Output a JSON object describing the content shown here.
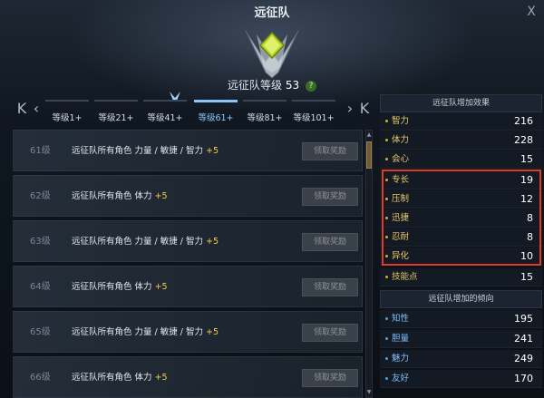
{
  "window": {
    "title": "远征队",
    "close_label": "X",
    "level_label": "远征队等级",
    "level_value": "53",
    "help_label": "?"
  },
  "tabs": {
    "first_label": "K",
    "prev_label": "‹",
    "next_label": "›",
    "last_label": "K",
    "items": [
      {
        "label": "等级1+"
      },
      {
        "label": "等级21+"
      },
      {
        "label": "等级41+"
      },
      {
        "label": "等级61+",
        "active": true
      },
      {
        "label": "等级81+"
      },
      {
        "label": "等级101+"
      }
    ]
  },
  "rewards": [
    {
      "level": "61级",
      "text": "远征队所有角色 力量 / 敏捷 / 智力",
      "bonus": "+5",
      "button": "领取奖励"
    },
    {
      "level": "62级",
      "text": "远征队所有角色 体力",
      "bonus": "+5",
      "button": "领取奖励"
    },
    {
      "level": "63级",
      "text": "远征队所有角色 力量 / 敏捷 / 智力",
      "bonus": "+5",
      "button": "领取奖励"
    },
    {
      "level": "64级",
      "text": "远征队所有角色 体力",
      "bonus": "+5",
      "button": "领取奖励"
    },
    {
      "level": "65级",
      "text": "远征队所有角色 力量 / 敏捷 / 智力",
      "bonus": "+5",
      "button": "领取奖励"
    },
    {
      "level": "66级",
      "text": "远征队所有角色 体力",
      "bonus": "+5",
      "button": "领取奖励"
    }
  ],
  "effects": {
    "header": "远征队增加效果",
    "stats": [
      {
        "name": "智力",
        "value": "216"
      },
      {
        "name": "体力",
        "value": "228"
      },
      {
        "name": "会心",
        "value": "15"
      },
      {
        "name": "专长",
        "value": "19"
      },
      {
        "name": "压制",
        "value": "12"
      },
      {
        "name": "迅捷",
        "value": "8"
      },
      {
        "name": "忍耐",
        "value": "8"
      },
      {
        "name": "异化",
        "value": "10"
      },
      {
        "name": "技能点",
        "value": "15"
      }
    ]
  },
  "tendency": {
    "header": "远征队增加的倾向",
    "stats": [
      {
        "name": "知性",
        "value": "195"
      },
      {
        "name": "胆量",
        "value": "241"
      },
      {
        "name": "魅力",
        "value": "249"
      },
      {
        "name": "友好",
        "value": "170"
      }
    ]
  },
  "colors": {
    "accent_blue": "#8cc8ff",
    "bonus_gold": "#f2cf4a",
    "highlight_red": "#e03a2a",
    "emblem_green": "#b8d82a"
  },
  "icons": {
    "emblem": "expedition-emblem-icon",
    "tab_marker": "expedition-marker-icon"
  }
}
